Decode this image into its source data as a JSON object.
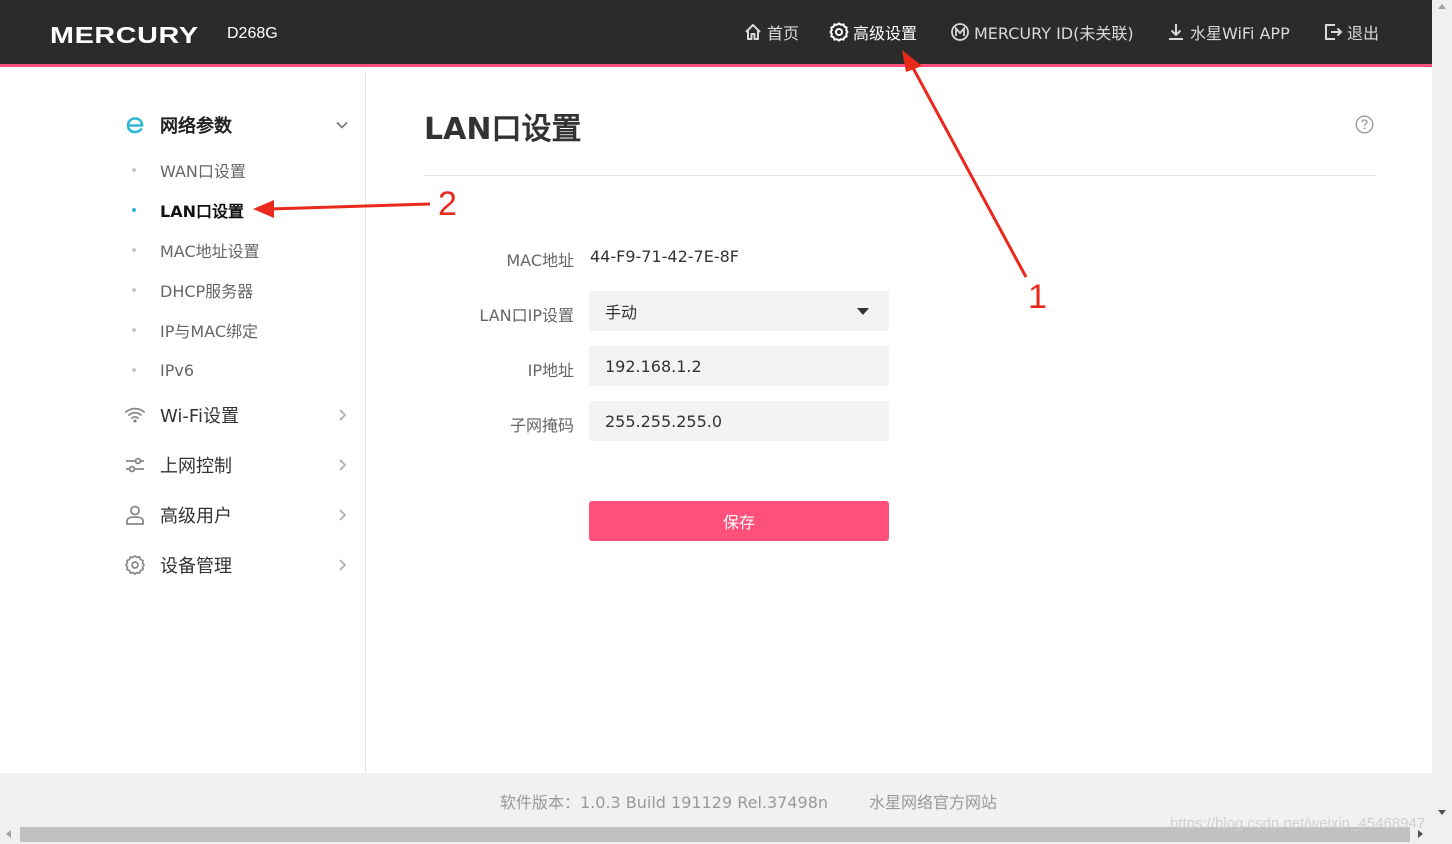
{
  "header": {
    "brand": "MERCURY",
    "model": "D268G",
    "nav": [
      {
        "label": "首页",
        "icon": "home-icon"
      },
      {
        "label": "高级设置",
        "icon": "gear-icon",
        "active": true
      },
      {
        "label": "MERCURY ID(未关联)",
        "icon": "mercury-id-icon"
      },
      {
        "label": "水星WiFi APP",
        "icon": "download-icon"
      },
      {
        "label": "退出",
        "icon": "logout-icon"
      }
    ]
  },
  "sidebar": {
    "groups": [
      {
        "label": "网络参数",
        "icon": "network-icon",
        "expanded": true,
        "items": [
          {
            "label": "WAN口设置"
          },
          {
            "label": "LAN口设置",
            "active": true
          },
          {
            "label": "MAC地址设置"
          },
          {
            "label": "DHCP服务器"
          },
          {
            "label": "IP与MAC绑定"
          },
          {
            "label": "IPv6"
          }
        ]
      },
      {
        "label": "Wi-Fi设置",
        "icon": "wifi-icon"
      },
      {
        "label": "上网控制",
        "icon": "sliders-icon"
      },
      {
        "label": "高级用户",
        "icon": "user-icon"
      },
      {
        "label": "设备管理",
        "icon": "device-gear-icon"
      }
    ]
  },
  "main": {
    "title": "LAN口设置",
    "help_icon": "help-icon",
    "form": {
      "mac_label": "MAC地址",
      "mac_value": "44-F9-71-42-7E-8F",
      "lan_ip_mode_label": "LAN口IP设置",
      "lan_ip_mode_value": "手动",
      "ip_label": "IP地址",
      "ip_value": "192.168.1.2",
      "mask_label": "子网掩码",
      "mask_value": "255.255.255.0",
      "save_label": "保存"
    }
  },
  "footer": {
    "version": "软件版本：1.0.3 Build 191129 Rel.37498n",
    "link": "水星网络官方网站"
  },
  "watermark": "https://blog.csdn.net/weixin_45468947",
  "annotations": [
    {
      "label": "1"
    },
    {
      "label": "2"
    }
  ],
  "colors": {
    "accent": "#ff4f7b",
    "header_bg": "#2b2b2b",
    "active_dot": "#2db7d6",
    "annotation": "#e8291c"
  }
}
